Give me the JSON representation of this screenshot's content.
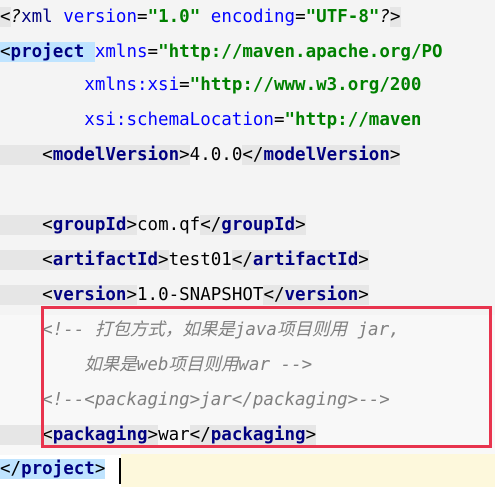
{
  "editor": {
    "lines": [
      {
        "parts": [
          [
            "punct",
            "<"
          ],
          [
            "pi",
            "?"
          ],
          [
            "kw-tag-plain",
            "xml "
          ],
          [
            "attr",
            "version"
          ],
          [
            "punct",
            "="
          ],
          [
            "str",
            "\"1.0\""
          ],
          [
            "punct",
            " "
          ],
          [
            "attr",
            "encoding"
          ],
          [
            "punct",
            "="
          ],
          [
            "str",
            "\"UTF-8\""
          ],
          [
            "pi",
            "?"
          ],
          [
            "punct",
            ">"
          ]
        ]
      },
      {
        "parts": [
          [
            "punct",
            "<"
          ],
          [
            "kw-tag",
            "project "
          ],
          [
            "attr",
            "xmlns"
          ],
          [
            "punct",
            "="
          ],
          [
            "str",
            "\"http://maven.apache.org/PO"
          ]
        ]
      },
      {
        "parts": [
          [
            "punct",
            "        "
          ],
          [
            "attr",
            "xmlns:xsi"
          ],
          [
            "punct",
            "="
          ],
          [
            "str",
            "\"http://www.w3.org/200"
          ]
        ]
      },
      {
        "parts": [
          [
            "punct",
            "        "
          ],
          [
            "attr",
            "xsi:schemaLocation"
          ],
          [
            "punct",
            "="
          ],
          [
            "str",
            "\"http://maven"
          ]
        ]
      },
      {
        "parts": [
          [
            "punct",
            "    <"
          ],
          [
            "kw-tag",
            "modelVersion"
          ],
          [
            "punct",
            ">"
          ],
          [
            "txt",
            "4.0.0"
          ],
          [
            "punct",
            "</"
          ],
          [
            "kw-tag",
            "modelVersion"
          ],
          [
            "punct",
            ">"
          ]
        ]
      },
      {
        "parts": []
      },
      {
        "parts": [
          [
            "punct",
            "    <"
          ],
          [
            "kw-tag",
            "groupId"
          ],
          [
            "punct",
            ">"
          ],
          [
            "txt",
            "com.qf"
          ],
          [
            "punct",
            "</"
          ],
          [
            "kw-tag",
            "groupId"
          ],
          [
            "punct",
            ">"
          ]
        ]
      },
      {
        "parts": [
          [
            "punct",
            "    <"
          ],
          [
            "kw-tag",
            "artifactId"
          ],
          [
            "punct",
            ">"
          ],
          [
            "txt",
            "test01"
          ],
          [
            "punct",
            "</"
          ],
          [
            "kw-tag",
            "artifactId"
          ],
          [
            "punct",
            ">"
          ]
        ]
      },
      {
        "parts": [
          [
            "punct",
            "    <"
          ],
          [
            "kw-tag",
            "version"
          ],
          [
            "punct",
            ">"
          ],
          [
            "txt",
            "1.0-SNAPSHOT"
          ],
          [
            "punct",
            "</"
          ],
          [
            "kw-tag",
            "version"
          ],
          [
            "punct",
            ">"
          ]
        ]
      },
      {
        "parts": [
          [
            "comment",
            "    <!-- 打包方式，如果是java项目则用 jar,"
          ]
        ]
      },
      {
        "parts": [
          [
            "comment",
            "        如果是web项目则用war -->"
          ]
        ]
      },
      {
        "parts": [
          [
            "comment",
            "    <!--<packaging>jar</packaging>-->"
          ]
        ]
      },
      {
        "parts": [
          [
            "punct",
            "    <"
          ],
          [
            "kw-tag",
            "packaging"
          ],
          [
            "punct",
            ">"
          ],
          [
            "txt",
            "war"
          ],
          [
            "punct",
            "</"
          ],
          [
            "kw-tag",
            "packaging"
          ],
          [
            "punct",
            ">"
          ]
        ]
      },
      {
        "parts": [
          [
            "punct",
            "</"
          ],
          [
            "kw-tag",
            "project"
          ],
          [
            "punct",
            ">"
          ]
        ]
      }
    ]
  },
  "colors": {
    "tag": "#000080",
    "attribute": "#0000ff",
    "string": "#008000",
    "comment": "#808080",
    "highlight_box": "#e8344e"
  }
}
